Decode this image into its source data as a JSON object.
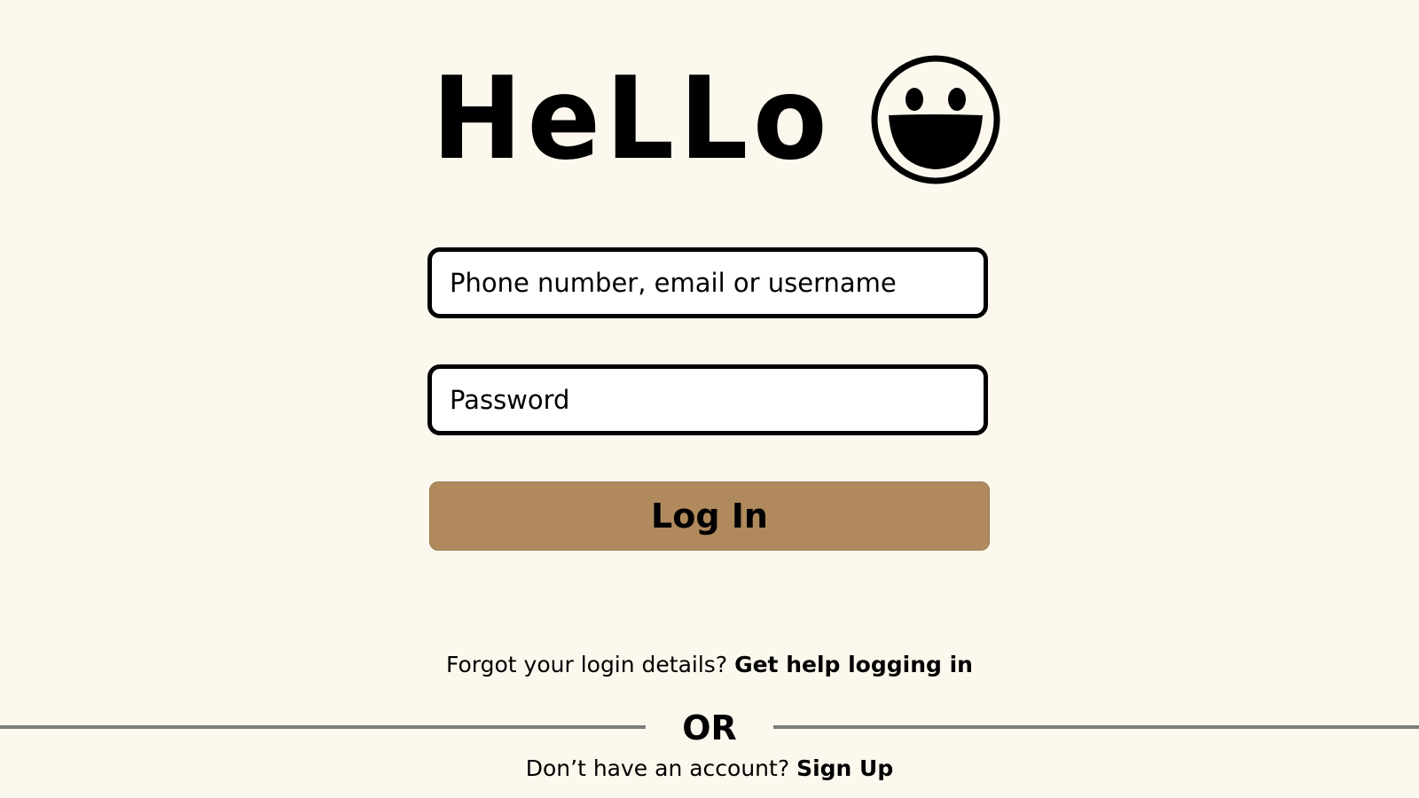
{
  "header": {
    "title": "HeLLo",
    "logo_icon": "smiley-face-icon"
  },
  "form": {
    "username_placeholder": "Phone number, email or username",
    "username_value": "",
    "password_placeholder": "Password",
    "password_value": "",
    "login_label": "Log In"
  },
  "help": {
    "prompt": "Forgot your login details?",
    "link": "Get help logging in"
  },
  "divider": {
    "text": "OR"
  },
  "signup": {
    "prompt": "Don’t have an account?",
    "link": "Sign Up"
  },
  "colors": {
    "background": "#fdf8ee",
    "button": "#b08a5d",
    "border": "#000000",
    "divider": "#7d7d7d"
  }
}
